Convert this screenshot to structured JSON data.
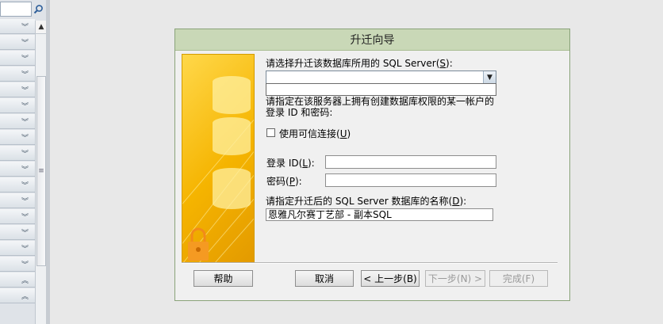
{
  "dialog": {
    "title": "升迁向导",
    "server_prompt_pre": "请选择升迁该数据库所用的 SQL Server(",
    "server_prompt_key": "S",
    "server_prompt_post": "):",
    "server_value": "",
    "login_prompt_line1": "请指定在该服务器上拥有创建数据库权限的某一帐户的",
    "login_prompt_line2": "登录 ID 和密码:",
    "trusted_label_pre": "使用可信连接(",
    "trusted_label_key": "U",
    "trusted_label_post": ")",
    "trusted_checked": false,
    "login_id_label_pre": "登录 ID(",
    "login_id_label_key": "L",
    "login_id_label_post": "):",
    "login_id_value": "",
    "password_label_pre": "密码(",
    "password_label_key": "P",
    "password_label_post": "):",
    "password_value": "",
    "db_prompt_pre": "请指定升迁后的 SQL Server 数据库的名称(",
    "db_prompt_key": "D",
    "db_prompt_post": "):",
    "db_name": "恩雅凡尔赛丁艺部 - 副本SQL"
  },
  "buttons": {
    "help": "帮助",
    "cancel": "取消",
    "back": "< 上一步(B)",
    "next": "下一步(N) >",
    "finish": "完成(F)"
  },
  "nav": {
    "rows": [
      "chev-down",
      "chev-down",
      "chev-down",
      "chev-down",
      "chev-down",
      "chev-down",
      "chev-down",
      "chev-down",
      "chev-down",
      "chev-down",
      "chev-down",
      "chev-down",
      "chev-down",
      "chev-down",
      "chev-down",
      "chev-down",
      "chev-up",
      "chev-up"
    ]
  },
  "colors": {
    "title_bar": "#c9d8b7",
    "wizard_gold": "#f5b400"
  }
}
